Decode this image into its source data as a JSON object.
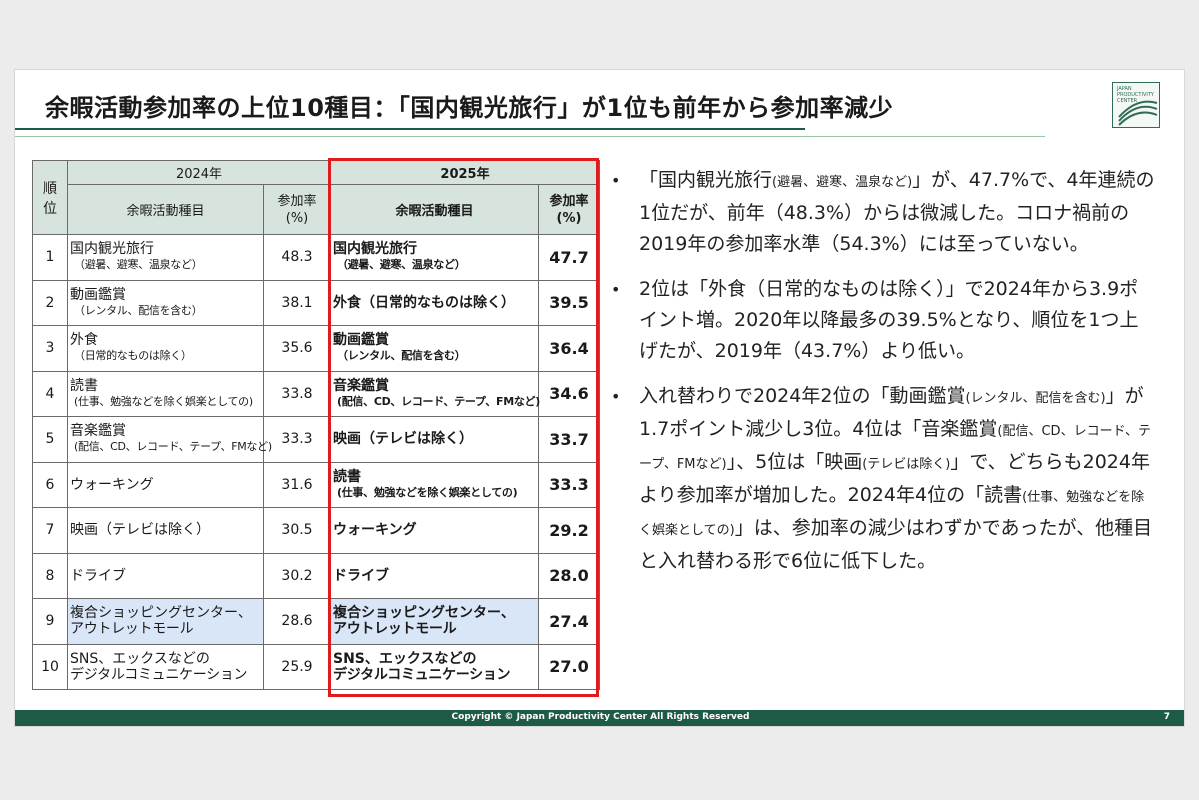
{
  "title": "余暇活動参加率の上位10種目：「国内観光旅行」が1位も前年から参加率減少",
  "logo": {
    "text": "JAPAN\nPRODUCTIVITY\nCENTER"
  },
  "table_2024": {
    "rank_header": "順\n位",
    "year": "2024年",
    "item_header": "余暇活動種目",
    "rate_header": "参加率\n(%)",
    "rows": [
      {
        "rank": "1",
        "main": "国内観光旅行",
        "sub": "（避暑、避寒、温泉など）",
        "value": "48.3"
      },
      {
        "rank": "2",
        "main": "動画鑑賞",
        "sub": "（レンタル、配信を含む）",
        "value": "38.1"
      },
      {
        "rank": "3",
        "main": "外食",
        "sub": "（日常的なものは除く）",
        "value": "35.6"
      },
      {
        "rank": "4",
        "main": "読書",
        "sub": "(仕事、勉強などを除く娯楽としての)",
        "value": "33.8"
      },
      {
        "rank": "5",
        "main": "音楽鑑賞",
        "sub": "(配信、CD、レコード、テープ、FMなど)",
        "value": "33.3"
      },
      {
        "rank": "6",
        "main": "ウォーキング",
        "sub": "",
        "value": "31.6"
      },
      {
        "rank": "7",
        "main": "映画（テレビは除く）",
        "sub": "",
        "value": "30.5"
      },
      {
        "rank": "8",
        "main": "ドライブ",
        "sub": "",
        "value": "30.2"
      },
      {
        "rank": "9",
        "main": "複合ショッピングセンター、",
        "sub": "アウトレットモール",
        "value": "28.6"
      },
      {
        "rank": "10",
        "main": "SNS、エックスなどの",
        "sub": "デジタルコミュニケーション",
        "value": "25.9"
      }
    ]
  },
  "table_2025": {
    "year": "2025年",
    "item_header": "余暇活動種目",
    "rate_header": "参加率\n(%)",
    "rows": [
      {
        "main": "国内観光旅行",
        "sub": "（避暑、避寒、温泉など）",
        "value": "47.7"
      },
      {
        "main": "外食（日常的なものは除く）",
        "sub": "",
        "value": "39.5"
      },
      {
        "main": "動画鑑賞",
        "sub": "（レンタル、配信を含む）",
        "value": "36.4"
      },
      {
        "main": "音楽鑑賞",
        "sub": "(配信、CD、レコード、テープ、FMなど)",
        "value": "34.6"
      },
      {
        "main": "映画（テレビは除く）",
        "sub": "",
        "value": "33.7"
      },
      {
        "main": "読書",
        "sub": "(仕事、勉強などを除く娯楽としての)",
        "value": "33.3"
      },
      {
        "main": "ウォーキング",
        "sub": "",
        "value": "29.2"
      },
      {
        "main": "ドライブ",
        "sub": "",
        "value": "28.0"
      },
      {
        "main": "複合ショッピングセンター、",
        "sub": "アウトレットモール",
        "value": "27.4"
      },
      {
        "main": "SNS、エックスなどの",
        "sub": "デジタルコミュニケーション",
        "value": "27.0"
      }
    ]
  },
  "bullets": [
    {
      "parts": [
        {
          "t": "「国内観光旅行"
        },
        {
          "t": "(避暑、避寒、温泉など)",
          "small": true
        },
        {
          "t": "」が、47.7%で、4年連続の1位だが、前年（48.3%）からは微減した。コロナ禍前の2019年の参加率水準（54.3%）には至っていない。"
        }
      ]
    },
    {
      "parts": [
        {
          "t": "2位は「外食（日常的なものは除く）」で2024年から3.9ポイント増。2020年以降最多の39.5%となり、順位を1つ上げたが、2019年（43.7%）より低い。"
        }
      ]
    },
    {
      "parts": [
        {
          "t": "入れ替わりで2024年2位の「動画鑑賞"
        },
        {
          "t": "(レンタル、配信を含む)",
          "small": true
        },
        {
          "t": "」が1.7ポイント減少し3位。4位は「音楽鑑賞"
        },
        {
          "t": "(配信、CD、レコード、テープ、FMなど)",
          "small": true
        },
        {
          "t": "」、5位は「映画"
        },
        {
          "t": "(テレビは除く)",
          "small": true
        },
        {
          "t": "」で、どちらも2024年より参加率が増加した。2024年4位の「読書"
        },
        {
          "t": "(仕事、勉強などを除く娯楽としての)",
          "small": true
        },
        {
          "t": "」は、参加率の減少はわずかであったが、他種目と入れ替わる形で6位に低下した。"
        }
      ]
    }
  ],
  "footer": {
    "copyright": "Copyright © Japan Productivity Center All Rights Reserved",
    "page": "7"
  }
}
